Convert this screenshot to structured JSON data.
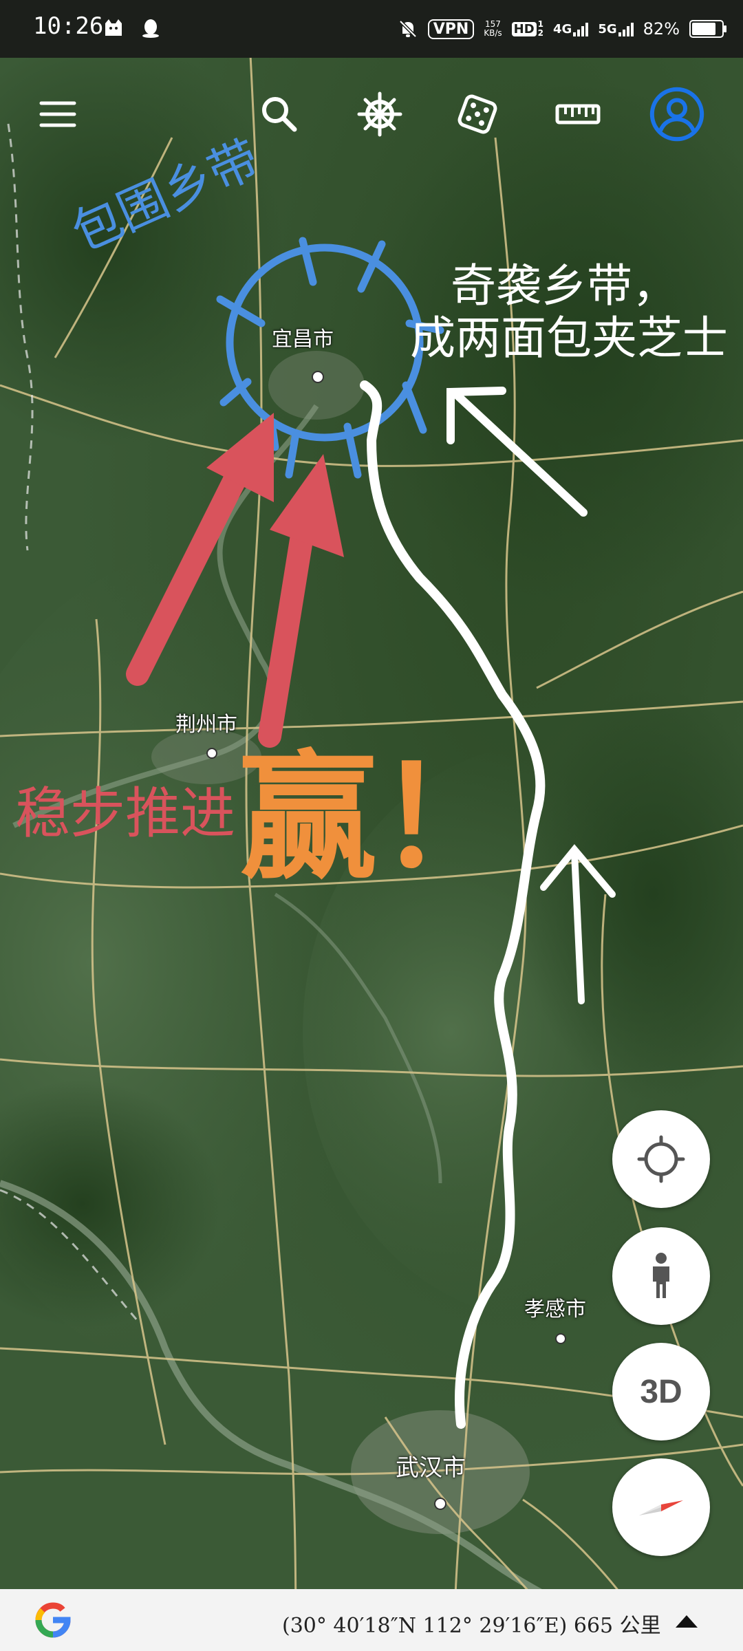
{
  "status_bar": {
    "time": "10:26",
    "vpn_label": "VPN",
    "net_speed_value": "157",
    "net_speed_unit": "KB/s",
    "hd_label": "HD",
    "hd_sim": "1",
    "hd_sim2": "2",
    "net_4g": "4G",
    "net_5g": "5G",
    "battery": "82%",
    "battery_level": 0.82,
    "icons": [
      "cat-icon",
      "qq-penguin-icon",
      "mute-bell-icon"
    ]
  },
  "toolbar": {
    "icons": [
      "menu-icon",
      "search-icon",
      "ship-wheel-icon",
      "dice-icon",
      "ruler-icon",
      "account-icon"
    ],
    "accent_color": "#1a73e8"
  },
  "map": {
    "cities": {
      "yichang": "宜昌市",
      "jingzhou": "荆州市",
      "xiaogan": "孝感市",
      "wuhan": "武汉市"
    },
    "annotations": {
      "encircle": "包围乡带",
      "surprise_line1": "奇袭乡带，",
      "surprise_line2": "成两面包夹芝士",
      "advance": "稳步推进",
      "win": "赢！"
    },
    "colors": {
      "blue": "#4a8fe0",
      "red": "#d9535c",
      "orange": "#f0903c",
      "white": "#ffffff"
    }
  },
  "controls": {
    "labels": {
      "three_d": "3D"
    },
    "icons": [
      "my-location-icon",
      "street-view-pegman-icon",
      "compass-icon"
    ]
  },
  "bottom_bar": {
    "coordinates": "(30° 40′18″N 112° 29′16″E) 665 公里",
    "logo": "google-g-logo",
    "expand_icon": "triangle-up-icon"
  }
}
